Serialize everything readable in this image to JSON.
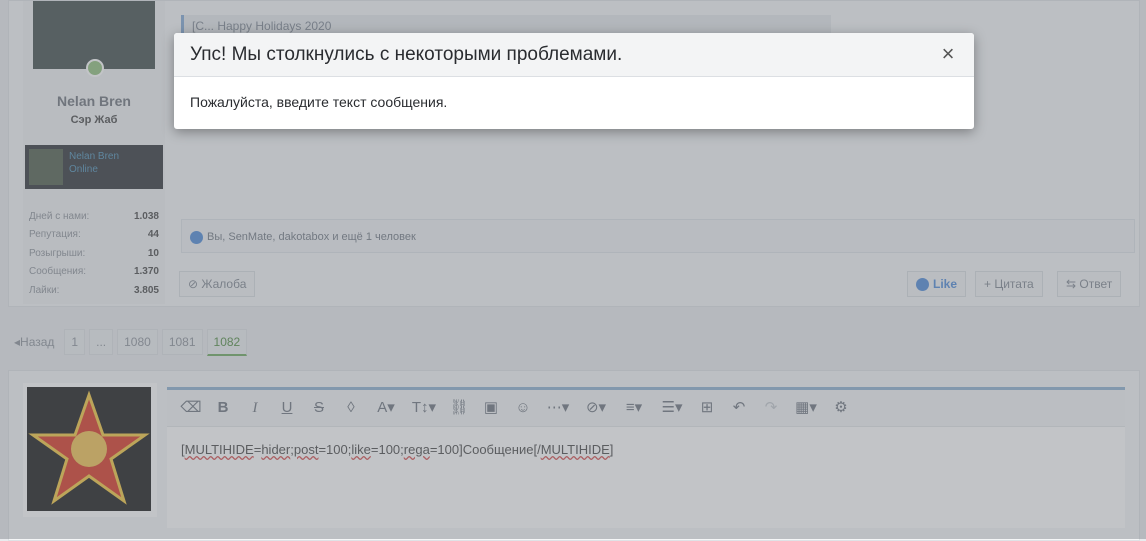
{
  "post": {
    "quote_text": "[C... Happy Holidays 2020",
    "user": {
      "name": "Nelan Bren",
      "title": "Сэр Жаб",
      "mini_name": "Nelan Bren",
      "mini_status": "Online"
    },
    "stats": [
      {
        "label": "Дней с нами:",
        "value": "1.038"
      },
      {
        "label": "Репутация:",
        "value": "44"
      },
      {
        "label": "Розыгрыши:",
        "value": "10"
      },
      {
        "label": "Сообщения:",
        "value": "1.370"
      },
      {
        "label": "Лайки:",
        "value": "3.805"
      }
    ],
    "likes_text": "Вы, SenMate, dakotabox и ещё 1 человек",
    "report_label": "Жалоба",
    "like_label": "Like",
    "quote_label": "+ Цитата",
    "reply_label": "Ответ"
  },
  "pagination": {
    "prev": "Назад",
    "pages": [
      "1",
      "...",
      "1080",
      "1081",
      "1082"
    ],
    "current": "1082"
  },
  "editor": {
    "content_parts": [
      "[",
      "MULTIHIDE",
      "=",
      "hider",
      ";",
      "post",
      "=100;",
      "like",
      "=100;",
      "rega",
      "=100]Сообщение[/",
      "MULTIHIDE",
      "]"
    ]
  },
  "modal": {
    "title": "Упс! Мы столкнулись с некоторыми проблемами.",
    "close_icon": "×",
    "message": "Пожалуйста, введите текст сообщения."
  },
  "colors": {
    "accent": "#4a87d8",
    "current_page": "#4d8a3e"
  }
}
